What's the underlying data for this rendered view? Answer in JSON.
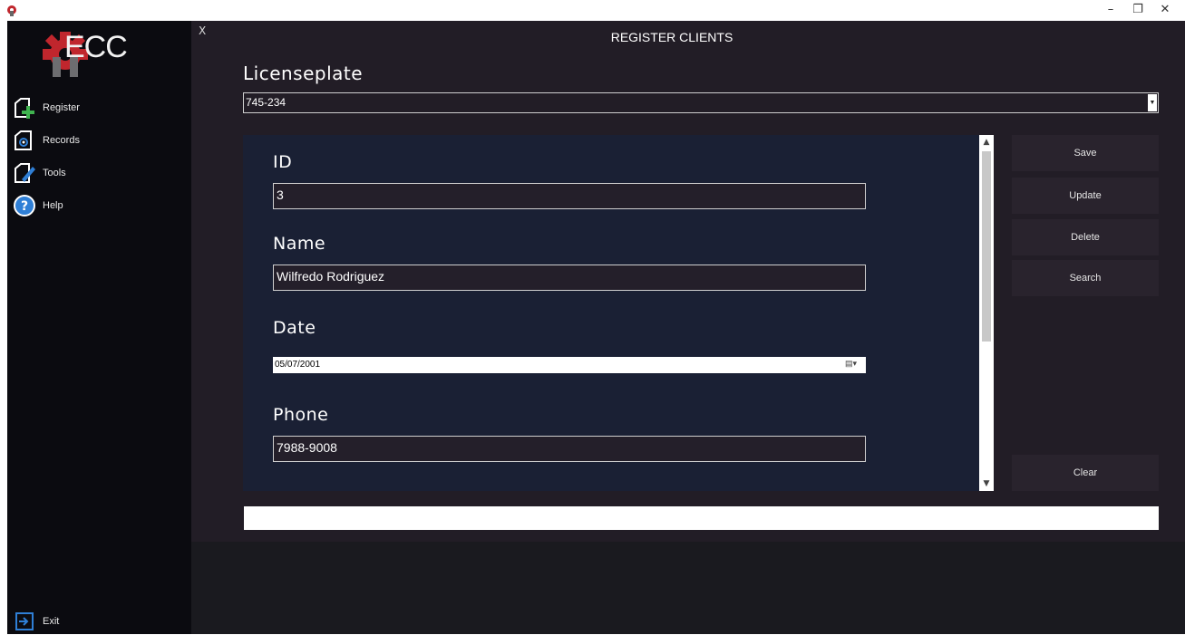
{
  "window": {
    "minimize": "–",
    "restore": "❐",
    "close": "✕"
  },
  "sidebar": {
    "logo_text": "ECC",
    "items": [
      {
        "label": "Register",
        "icon": "register-add-icon"
      },
      {
        "label": "Records",
        "icon": "records-icon"
      },
      {
        "label": "Tools",
        "icon": "tools-edit-icon"
      },
      {
        "label": "Help",
        "icon": "help-icon"
      }
    ],
    "exit_label": "Exit"
  },
  "main": {
    "close_label": "X",
    "title": "REGISTER CLIENTS",
    "licenseplate_label": "Licenseplate",
    "licenseplate_value": "745-234",
    "fields": {
      "id_label": "ID",
      "id_value": "3",
      "name_label": "Name",
      "name_value": "Wilfredo Rodriguez",
      "date_label": "Date",
      "date_value": "05/07/2001",
      "phone_label": "Phone",
      "phone_value": "7988-9008"
    },
    "buttons": {
      "save": "Save",
      "update": "Update",
      "delete": "Delete",
      "search": "Search",
      "clear": "Clear"
    }
  },
  "colors": {
    "sidebar_bg": "#0b0b10",
    "main_bg": "#221d26",
    "panel_bg": "#1a2034",
    "accent_green": "#3fb34f",
    "accent_blue": "#2f7fd6",
    "logo_red": "#c0262d"
  }
}
